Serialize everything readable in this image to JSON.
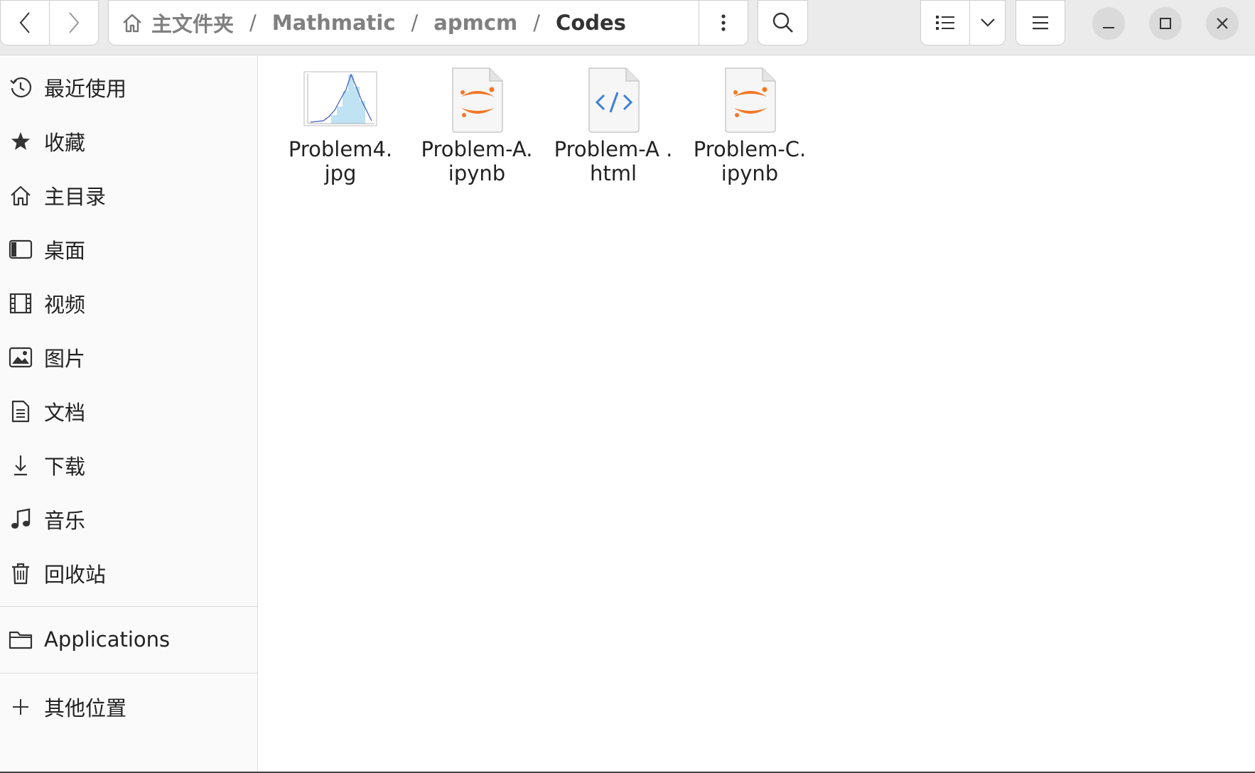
{
  "pathbar": {
    "segments": [
      "主文件夹",
      "Mathmatic",
      "apmcm",
      "Codes"
    ],
    "separator": "/"
  },
  "sidebar": {
    "items": [
      {
        "label": "最近使用",
        "icon": "clock-icon"
      },
      {
        "label": "收藏",
        "icon": "star-icon"
      },
      {
        "label": "主目录",
        "icon": "home-icon"
      },
      {
        "label": "桌面",
        "icon": "desktop-icon"
      },
      {
        "label": "视频",
        "icon": "film-icon"
      },
      {
        "label": "图片",
        "icon": "image-icon"
      },
      {
        "label": "文档",
        "icon": "document-icon"
      },
      {
        "label": "下载",
        "icon": "download-icon"
      },
      {
        "label": "音乐",
        "icon": "music-icon"
      },
      {
        "label": "回收站",
        "icon": "trash-icon"
      }
    ],
    "applications": {
      "label": "Applications",
      "icon": "folder-icon"
    },
    "other_locations": {
      "label": "其他位置",
      "icon": "plus-icon"
    }
  },
  "files": [
    {
      "name": "Problem4.\njpg",
      "type": "image",
      "icon": "chart-thumbnail-icon"
    },
    {
      "name": "Problem-A.\nipynb",
      "type": "notebook",
      "icon": "jupyter-icon"
    },
    {
      "name": "Problem-A .\nhtml",
      "type": "html",
      "icon": "code-icon"
    },
    {
      "name": "Problem-C.\nipynb",
      "type": "notebook",
      "icon": "jupyter-icon"
    }
  ],
  "colors": {
    "headerbar_bg": "#ebebeb",
    "sidebar_bg": "#fafafa",
    "jupyter_orange": "#f37726",
    "html_blue": "#3d7fd9"
  }
}
